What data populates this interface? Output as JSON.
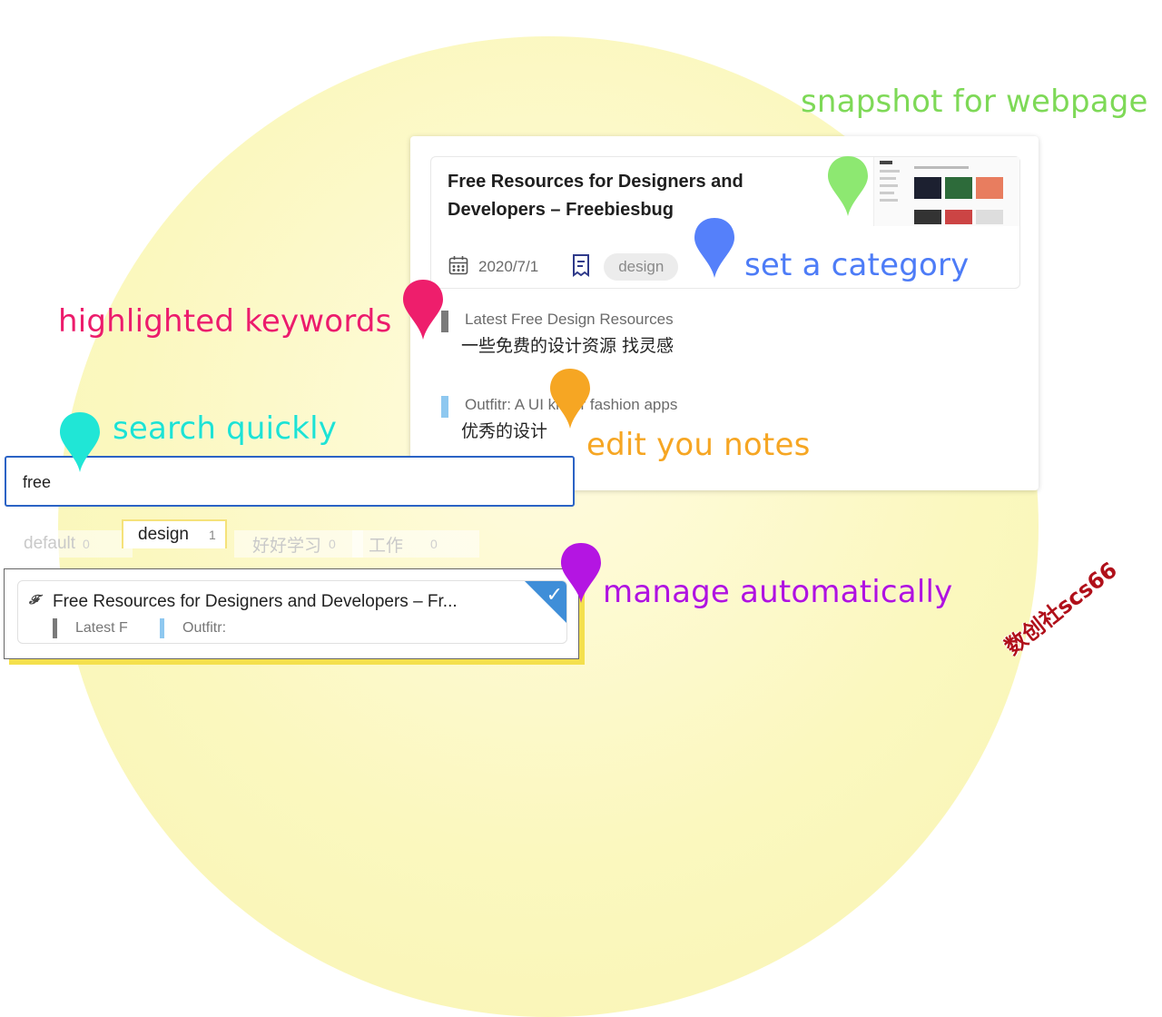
{
  "callouts": {
    "snapshot": {
      "text": "snapshot for webpage",
      "color": "#7ed957"
    },
    "category": {
      "text": "set a category",
      "color": "#4d7cf7"
    },
    "highlight": {
      "text": "highlighted keywords",
      "color": "#ec1c6b"
    },
    "search": {
      "text": "search quickly",
      "color": "#1de3d4"
    },
    "notes": {
      "text": "edit you notes",
      "color": "#f6a623"
    },
    "manage": {
      "text": "manage automatically",
      "color": "#b012e0"
    }
  },
  "card": {
    "title": "Free Resources for Designers and Developers – Freebiesbug",
    "date": "2020/7/1",
    "category": "design",
    "calendar_icon": "calendar-icon",
    "receipt_icon": "receipt-icon",
    "notes": [
      {
        "quote": "Latest Free Design Resources",
        "text": "一些免费的设计资源 找灵感",
        "bar_color": "#7a7a7a"
      },
      {
        "quote": "Outfitr: A UI kit for fashion apps",
        "text": "优秀的设计",
        "bar_color": "#8ec8f0"
      }
    ]
  },
  "search": {
    "value": "free"
  },
  "tabs": [
    {
      "label": "default",
      "count": "0"
    },
    {
      "label": "design",
      "count": "1"
    },
    {
      "label": "好好学习",
      "count": "0"
    },
    {
      "label": "工作",
      "count": "0"
    }
  ],
  "result": {
    "title": "Free Resources for Designers and Developers – Fr...",
    "fav_icon": "𝓕",
    "notes": [
      {
        "text": "Latest F",
        "bar_color": "#7a7a7a"
      },
      {
        "text": "Outfitr:",
        "bar_color": "#8ec8f0"
      }
    ],
    "check": "✓"
  },
  "watermark": "数创社scs66"
}
